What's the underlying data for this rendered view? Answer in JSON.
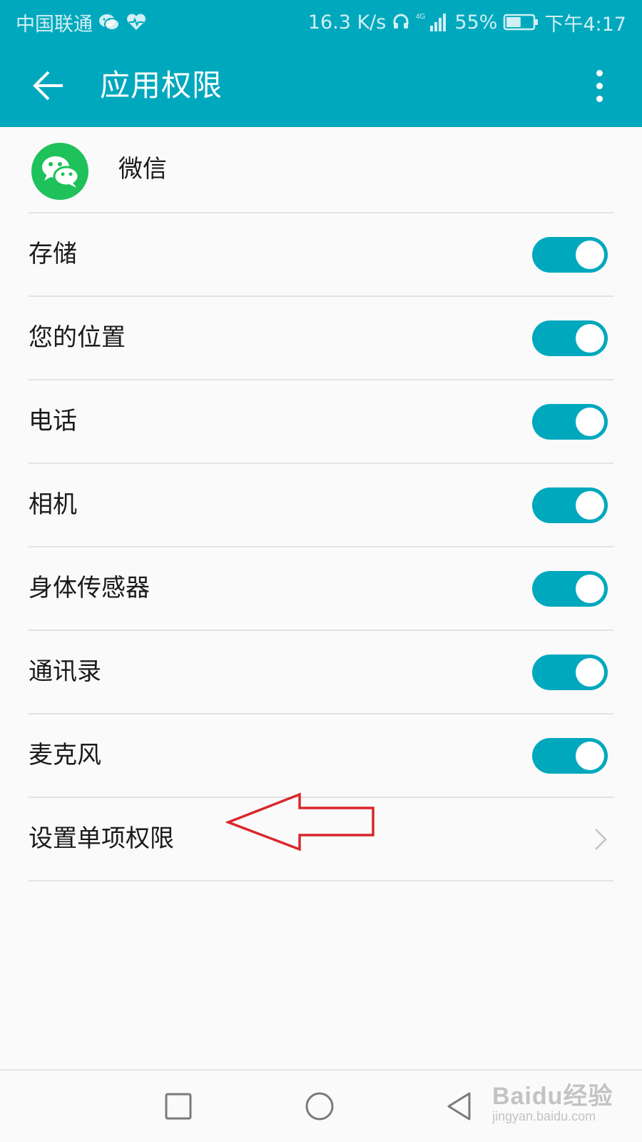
{
  "status_bar": {
    "carrier": "中国联通",
    "network_speed": "16.3 K/s",
    "network_type": "4G",
    "battery_percent": "55%",
    "battery_level": 0.55,
    "time": "下午4:17",
    "icons": [
      "wechat-icon",
      "health-icon",
      "headset-icon",
      "signal-icon",
      "battery-icon"
    ]
  },
  "app_bar": {
    "title": "应用权限",
    "back_icon": "arrow-left-icon",
    "more_icon": "more-vert-icon"
  },
  "app": {
    "name": "微信",
    "icon": "wechat-icon",
    "icon_color": "#1fc15b"
  },
  "permissions": [
    {
      "label": "存储",
      "enabled": true
    },
    {
      "label": "您的位置",
      "enabled": true
    },
    {
      "label": "电话",
      "enabled": true
    },
    {
      "label": "相机",
      "enabled": true
    },
    {
      "label": "身体传感器",
      "enabled": true
    },
    {
      "label": "通讯录",
      "enabled": true
    },
    {
      "label": "麦克风",
      "enabled": true
    }
  ],
  "single_permission": {
    "label": "设置单项权限",
    "icon": "chevron-right-icon"
  },
  "annotation": {
    "icon": "arrow-left-outline-icon",
    "color": "#d9262b"
  },
  "nav_bar": {
    "icons": [
      "recent-apps-icon",
      "home-icon",
      "back-triangle-icon"
    ]
  },
  "watermark": {
    "logo": "Baidu经验",
    "url": "jingyan.baidu.com"
  },
  "colors": {
    "accent": "#00a8be",
    "toggle_on": "#00a8be",
    "background": "#fafafa",
    "divider": "#e3e3e3"
  }
}
